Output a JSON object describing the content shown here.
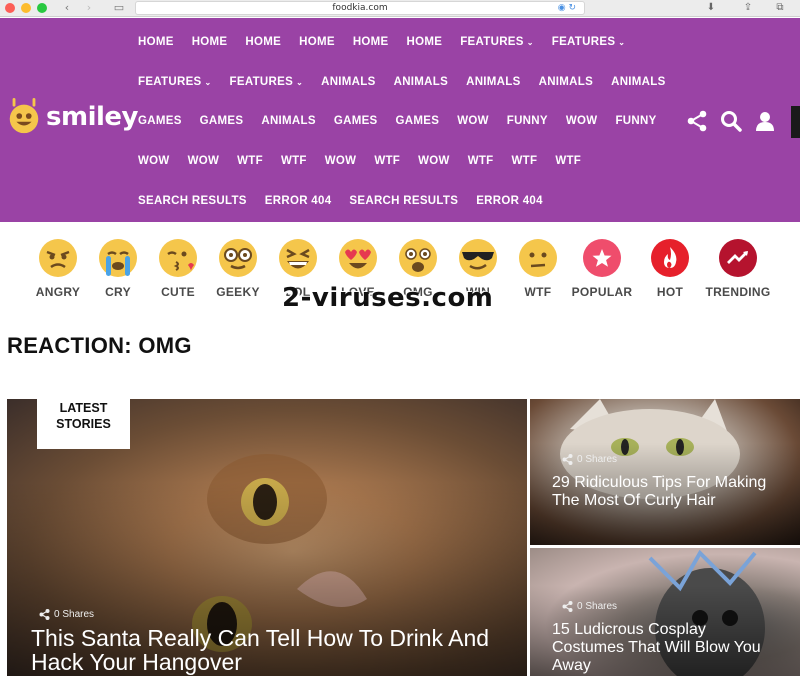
{
  "browser": {
    "address": "foodkia.com"
  },
  "header": {
    "logo_text": "smiley",
    "nav_rows": [
      [
        {
          "label": "HOME",
          "dropdown": false
        },
        {
          "label": "HOME",
          "dropdown": false
        },
        {
          "label": "HOME",
          "dropdown": false
        },
        {
          "label": "HOME",
          "dropdown": false
        },
        {
          "label": "HOME",
          "dropdown": false
        },
        {
          "label": "HOME",
          "dropdown": false
        },
        {
          "label": "FEATURES",
          "dropdown": true
        },
        {
          "label": "FEATURES",
          "dropdown": true
        }
      ],
      [
        {
          "label": "FEATURES",
          "dropdown": true
        },
        {
          "label": "FEATURES",
          "dropdown": true
        },
        {
          "label": "ANIMALS",
          "dropdown": false
        },
        {
          "label": "ANIMALS",
          "dropdown": false
        },
        {
          "label": "ANIMALS",
          "dropdown": false
        },
        {
          "label": "ANIMALS",
          "dropdown": false
        },
        {
          "label": "ANIMALS",
          "dropdown": false
        }
      ],
      [
        {
          "label": "GAMES",
          "dropdown": false
        },
        {
          "label": "GAMES",
          "dropdown": false
        },
        {
          "label": "ANIMALS",
          "dropdown": false
        },
        {
          "label": "GAMES",
          "dropdown": false
        },
        {
          "label": "GAMES",
          "dropdown": false
        },
        {
          "label": "WOW",
          "dropdown": false
        },
        {
          "label": "FUNNY",
          "dropdown": false
        },
        {
          "label": "WOW",
          "dropdown": false
        },
        {
          "label": "FUNNY",
          "dropdown": false
        }
      ],
      [
        {
          "label": "WOW",
          "dropdown": false
        },
        {
          "label": "WOW",
          "dropdown": false
        },
        {
          "label": "WTF",
          "dropdown": false
        },
        {
          "label": "WTF",
          "dropdown": false
        },
        {
          "label": "WOW",
          "dropdown": false
        },
        {
          "label": "WTF",
          "dropdown": false
        },
        {
          "label": "WOW",
          "dropdown": false
        },
        {
          "label": "WTF",
          "dropdown": false
        },
        {
          "label": "WTF",
          "dropdown": false
        },
        {
          "label": "WTF",
          "dropdown": false
        }
      ],
      [
        {
          "label": "SEARCH RESULTS",
          "dropdown": false
        },
        {
          "label": "ERROR 404",
          "dropdown": false
        },
        {
          "label": "SEARCH RESULTS",
          "dropdown": false
        },
        {
          "label": "ERROR 404",
          "dropdown": false
        }
      ]
    ],
    "icons": [
      "share-icon",
      "search-icon",
      "user-icon"
    ],
    "colors": {
      "brand": "#9a43a5",
      "logo_yellow": "#f5c64b"
    }
  },
  "reactions": [
    {
      "label": "ANGRY",
      "icon": "angry-face-icon"
    },
    {
      "label": "CRY",
      "icon": "crying-face-icon"
    },
    {
      "label": "CUTE",
      "icon": "kissing-face-icon"
    },
    {
      "label": "GEEKY",
      "icon": "geeky-face-icon"
    },
    {
      "label": "LOL",
      "icon": "laughing-face-icon"
    },
    {
      "label": "LOVE",
      "icon": "heart-eyes-face-icon"
    },
    {
      "label": "OMG",
      "icon": "surprised-face-icon"
    },
    {
      "label": "WIN",
      "icon": "sunglasses-face-icon"
    },
    {
      "label": "WTF",
      "icon": "confused-face-icon"
    },
    {
      "label": "POPULAR",
      "icon": "star-icon",
      "color": "#ef4d6c"
    },
    {
      "label": "HOT",
      "icon": "fire-icon",
      "color": "#e6202b"
    },
    {
      "label": "TRENDING",
      "icon": "trending-icon",
      "color": "#b5132e"
    }
  ],
  "watermark": "2-viruses.com",
  "page_title": "REACTION: OMG",
  "stories": {
    "badge_line1": "LATEST",
    "badge_line2": "STORIES",
    "main": {
      "shares": "0 Shares",
      "title": "This Santa Really Can Tell How To Drink And Hack Your Hangover"
    },
    "side": [
      {
        "shares": "0 Shares",
        "title": "29 Ridiculous Tips For Making The Most Of Curly Hair"
      },
      {
        "shares": "0 Shares",
        "title": "15 Ludicrous Cosplay Costumes That Will Blow You Away"
      }
    ]
  }
}
